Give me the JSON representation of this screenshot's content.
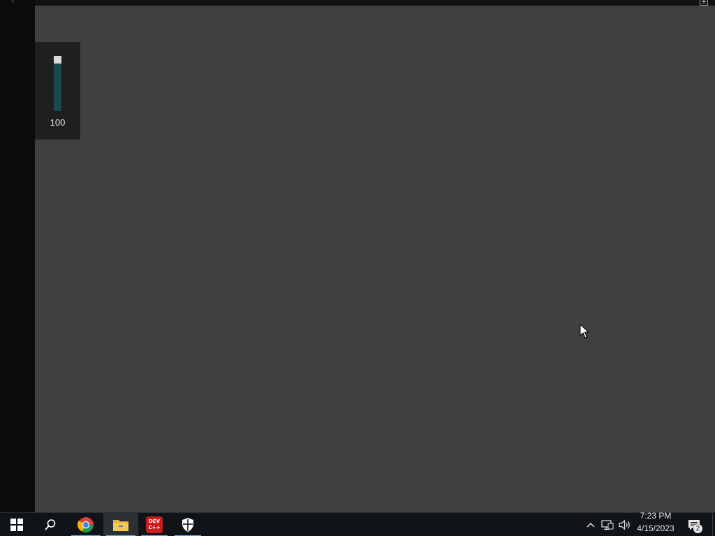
{
  "volume_flyout": {
    "value": "100",
    "level_percent": 100
  },
  "taskbar": {
    "apps": [
      {
        "name": "Start",
        "icon": "windows-start-icon"
      },
      {
        "name": "Search",
        "icon": "search-icon"
      },
      {
        "name": "Google Chrome",
        "icon": "chrome-icon"
      },
      {
        "name": "File Explorer",
        "icon": "folder-icon"
      },
      {
        "name": "Dev-C++",
        "icon": "devcpp-icon",
        "label_line1": "DEV",
        "label_line2": "C++"
      },
      {
        "name": "Windows Security",
        "icon": "shield-icon"
      }
    ],
    "tray": {
      "time": "7:23 PM",
      "date": "4/15/2023",
      "notification_count": "2"
    }
  },
  "colors": {
    "desktop_bg": "#404040",
    "flyout_bg": "#1f1f1f",
    "volume_track": "#1b4a4e",
    "taskbar_bg": "#101418",
    "accent_underline": "#7fb4e6",
    "devcpp_red": "#c81e1e"
  }
}
